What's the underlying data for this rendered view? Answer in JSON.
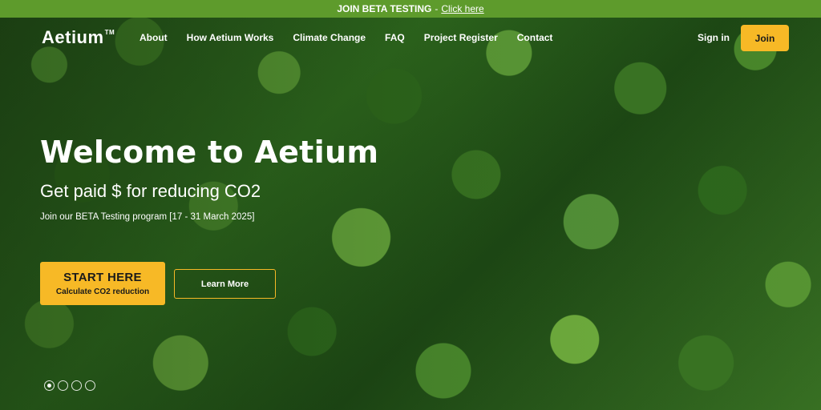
{
  "banner": {
    "text": "JOIN BETA TESTING",
    "separator": "-",
    "link_label": "Click here"
  },
  "nav": {
    "logo": "Aetium",
    "trademark": "TM",
    "links": [
      {
        "label": "About"
      },
      {
        "label": "How Aetium Works"
      },
      {
        "label": "Climate Change"
      },
      {
        "label": "FAQ"
      },
      {
        "label": "Project Register"
      },
      {
        "label": "Contact"
      }
    ],
    "sign_in": "Sign in",
    "join": "Join"
  },
  "hero": {
    "title": "Welcome to Aetium",
    "subtitle": "Get paid $ for reducing CO2",
    "note": "Join our BETA Testing program [17 - 31 March 2025]",
    "cta_primary": {
      "label": "START HERE",
      "sublabel": "Calculate CO2 reduction"
    },
    "cta_secondary": "Learn More"
  },
  "slider": {
    "slide_count": 4,
    "active_index": 0
  },
  "colors": {
    "banner_green": "#5e9b2c",
    "accent_yellow": "#f7b926"
  },
  "icons": {
    "slide_dot": "circle-outline",
    "slide_dot_active": "circle-dot"
  }
}
